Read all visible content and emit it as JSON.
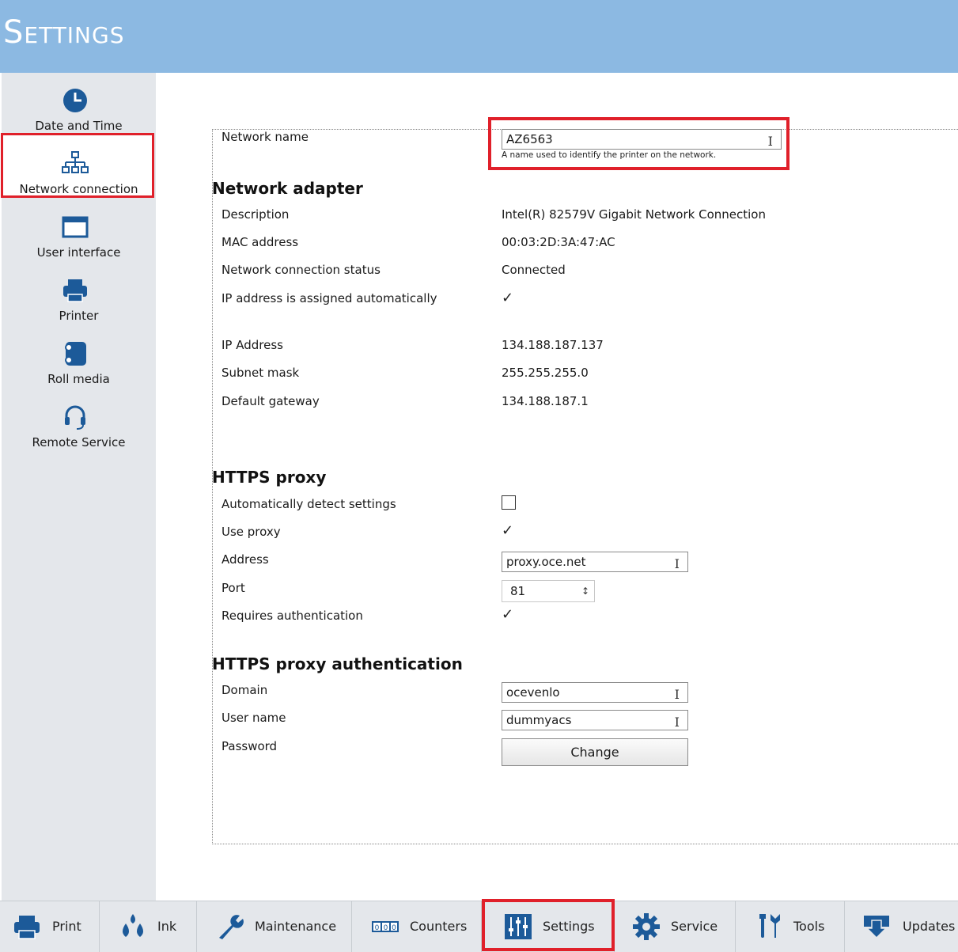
{
  "header": {
    "title": "Settings"
  },
  "sidebar": {
    "items": [
      {
        "label": "Date and Time",
        "icon": "clock-icon"
      },
      {
        "label": "Network connection",
        "icon": "network-icon",
        "active": true
      },
      {
        "label": "User interface",
        "icon": "window-icon"
      },
      {
        "label": "Printer",
        "icon": "printer-icon"
      },
      {
        "label": "Roll media",
        "icon": "roll-media-icon"
      },
      {
        "label": "Remote Service",
        "icon": "headset-icon"
      }
    ]
  },
  "network": {
    "name_label": "Network name",
    "name_value": "AZ6563",
    "name_hint": "A name used to identify the printer on the network."
  },
  "adapter": {
    "heading": "Network adapter",
    "rows": [
      {
        "label": "Description",
        "value": "Intel(R) 82579V Gigabit Network Connection"
      },
      {
        "label": "MAC address",
        "value": "00:03:2D:3A:47:AC"
      },
      {
        "label": "Network connection status",
        "value": "Connected"
      },
      {
        "label": "IP address is assigned automatically",
        "checked": true
      },
      {
        "label": "IP Address",
        "value": "134.188.187.137"
      },
      {
        "label": "Subnet mask",
        "value": "255.255.255.0"
      },
      {
        "label": "Default gateway",
        "value": "134.188.187.1"
      }
    ]
  },
  "proxy": {
    "heading": "HTTPS proxy",
    "auto_detect_label": "Automatically detect settings",
    "auto_detect_checked": false,
    "use_proxy_label": "Use proxy",
    "use_proxy_checked": true,
    "address_label": "Address",
    "address_value": "proxy.oce.net",
    "port_label": "Port",
    "port_value": "81",
    "requires_auth_label": "Requires authentication",
    "requires_auth_checked": true
  },
  "proxy_auth": {
    "heading": "HTTPS proxy authentication",
    "domain_label": "Domain",
    "domain_value": "ocevenlo",
    "username_label": "User name",
    "username_value": "dummyacs",
    "password_label": "Password",
    "change_button": "Change"
  },
  "bottom_tabs": [
    {
      "label": "Print",
      "icon": "printer-icon"
    },
    {
      "label": "Ink",
      "icon": "ink-drops-icon"
    },
    {
      "label": "Maintenance",
      "icon": "wrench-icon"
    },
    {
      "label": "Counters",
      "icon": "counter-icon"
    },
    {
      "label": "Settings",
      "icon": "sliders-icon",
      "active": true
    },
    {
      "label": "Service",
      "icon": "gear-icon"
    },
    {
      "label": "Tools",
      "icon": "tools-icon"
    },
    {
      "label": "Updates",
      "icon": "download-icon"
    }
  ],
  "colors": {
    "header": "#8cb9e2",
    "accent_icon": "#1c5a99",
    "highlight": "#e0202a",
    "sidebar_bg": "#e4e7eb"
  }
}
